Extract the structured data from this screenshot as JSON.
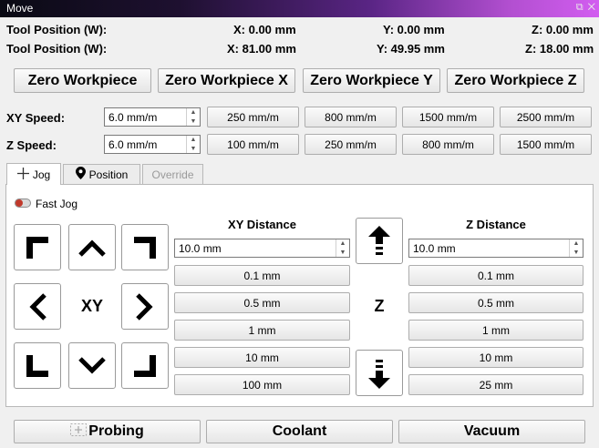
{
  "window": {
    "title": "Move",
    "controls": "⧉ ✕"
  },
  "positions": [
    {
      "label": "Tool Position (W):",
      "x": "X: 0.00 mm",
      "y": "Y: 0.00 mm",
      "z": "Z: 0.00 mm"
    },
    {
      "label": "Tool Position (W):",
      "x": "X: 81.00 mm",
      "y": "Y: 49.95 mm",
      "z": "Z: 18.00 mm"
    }
  ],
  "zero_buttons": [
    "Zero Workpiece",
    "Zero Workpiece X",
    "Zero Workpiece Y",
    "Zero Workpiece Z"
  ],
  "xy_speed": {
    "label": "XY Speed:",
    "value": "6.0 mm/m",
    "presets": [
      "250 mm/m",
      "800 mm/m",
      "1500 mm/m",
      "2500 mm/m"
    ]
  },
  "z_speed": {
    "label": "Z Speed:",
    "value": "6.0 mm/m",
    "presets": [
      "100 mm/m",
      "250 mm/m",
      "800 mm/m",
      "1500 mm/m"
    ]
  },
  "tabs": [
    {
      "label": "Jog",
      "icon": "move-icon",
      "state": "active"
    },
    {
      "label": "Position",
      "icon": "map-pin-icon",
      "state": "normal"
    },
    {
      "label": "Override",
      "icon": "",
      "state": "disabled"
    }
  ],
  "jog": {
    "fast_jog_label": "Fast Jog",
    "xy_center_label": "XY",
    "z_center_label": "Z",
    "xy_distance": {
      "title": "XY Distance",
      "value": "10.0 mm",
      "presets": [
        "0.1 mm",
        "0.5 mm",
        "1 mm",
        "10 mm",
        "100 mm"
      ]
    },
    "z_distance": {
      "title": "Z Distance",
      "value": "10.0 mm",
      "presets": [
        "0.1 mm",
        "0.5 mm",
        "1 mm",
        "10 mm",
        "25 mm"
      ]
    }
  },
  "bottom_buttons": {
    "probing": "Probing",
    "probing_icon": "probe-icon",
    "coolant": "Coolant",
    "vacuum": "Vacuum"
  }
}
